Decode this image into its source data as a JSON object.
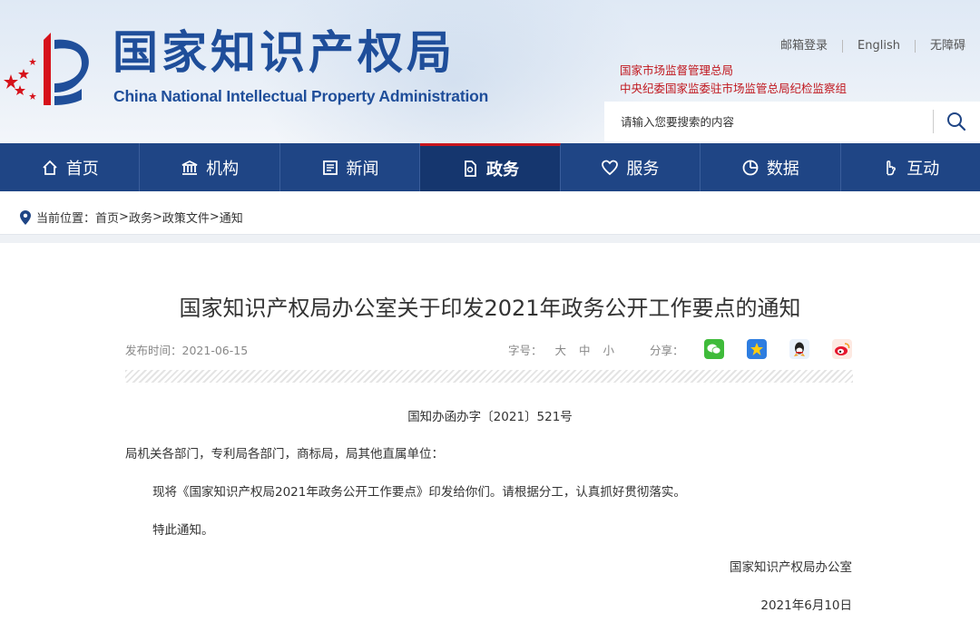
{
  "header": {
    "logo_cn": "国家知识产权局",
    "logo_en": "China National Intellectual Property Administration",
    "top_links": [
      "邮箱登录",
      "English",
      "无障碍"
    ],
    "org_line1": "国家市场监督管理总局",
    "org_line2": "中央纪委国家监委驻市场监管总局纪检监察组",
    "search_placeholder": "请输入您要搜索的内容"
  },
  "nav": {
    "items": [
      {
        "label": "首页",
        "icon": "home-icon"
      },
      {
        "label": "机构",
        "icon": "building-icon"
      },
      {
        "label": "新闻",
        "icon": "newspaper-icon"
      },
      {
        "label": "政务",
        "icon": "document-icon",
        "active": true
      },
      {
        "label": "服务",
        "icon": "heart-icon"
      },
      {
        "label": "数据",
        "icon": "pie-chart-icon"
      },
      {
        "label": "互动",
        "icon": "hand-icon"
      }
    ]
  },
  "breadcrumb": {
    "prefix": "当前位置：",
    "items": [
      "首页",
      "政务",
      "政策文件",
      "通知"
    ],
    "separator": ">"
  },
  "article": {
    "title": "国家知识产权局办公室关于印发2021年政务公开工作要点的通知",
    "publish_label": "发布时间：",
    "publish_date": "2021-06-15",
    "font_size_label": "字号：",
    "font_sizes": [
      "大",
      "中",
      "小"
    ],
    "share_label": "分享：",
    "share_icons": [
      "wechat-icon",
      "qzone-icon",
      "qq-icon",
      "weibo-icon"
    ],
    "doc_number": "国知办函办字〔2021〕521号",
    "addressee": "局机关各部门，专利局各部门，商标局，局其他直属单位：",
    "body": "现将《国家知识产权局2021年政务公开工作要点》印发给你们。请根据分工，认真抓好贯彻落实。",
    "closing": "特此通知。",
    "signature": "国家知识产权局办公室",
    "sign_date": "2021年6月10日"
  },
  "colors": {
    "brand_blue": "#1f4e9a",
    "nav_bg": "#1f4585",
    "nav_active": "#15366e",
    "accent_red": "#c8161e"
  }
}
